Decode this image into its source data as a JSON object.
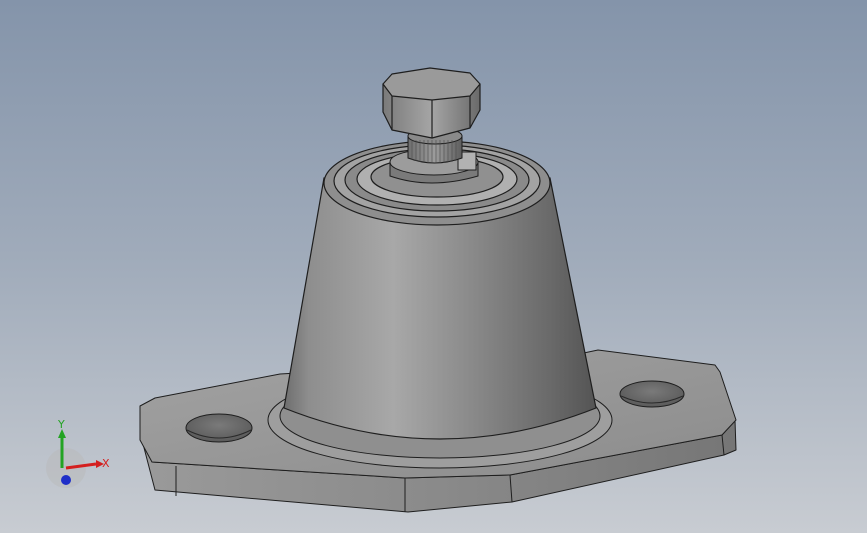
{
  "viewport": {
    "background_top": "#8494aa",
    "background_bottom": "#c8ccd2"
  },
  "model": {
    "part_color": "#9a9a9a",
    "edge_color": "#1e1e1e"
  },
  "triad": {
    "x_label": "X",
    "y_label": "Y",
    "x_color": "#d41f1f",
    "y_color": "#23a323",
    "z_color": "#1f2fc8"
  }
}
